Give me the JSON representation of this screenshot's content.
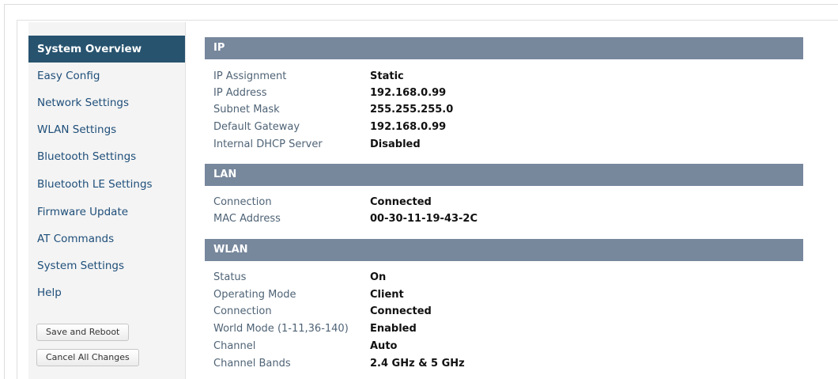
{
  "sidebar": {
    "items": [
      {
        "label": "System Overview"
      },
      {
        "label": "Easy Config"
      },
      {
        "label": "Network Settings"
      },
      {
        "label": "WLAN Settings"
      },
      {
        "label": "Bluetooth Settings"
      },
      {
        "label": "Bluetooth LE Settings"
      },
      {
        "label": "Firmware Update"
      },
      {
        "label": "AT Commands"
      },
      {
        "label": "System Settings"
      },
      {
        "label": "Help"
      }
    ],
    "save_button": "Save and Reboot",
    "cancel_button": "Cancel All Changes"
  },
  "sections": {
    "ip": {
      "title": "IP",
      "rows": [
        {
          "label": "IP Assignment",
          "value": "Static"
        },
        {
          "label": "IP Address",
          "value": "192.168.0.99"
        },
        {
          "label": "Subnet Mask",
          "value": "255.255.255.0"
        },
        {
          "label": "Default Gateway",
          "value": "192.168.0.99"
        },
        {
          "label": "Internal DHCP Server",
          "value": "Disabled"
        }
      ]
    },
    "lan": {
      "title": "LAN",
      "rows": [
        {
          "label": "Connection",
          "value": "Connected"
        },
        {
          "label": "MAC Address",
          "value": "00-30-11-19-43-2C"
        }
      ]
    },
    "wlan": {
      "title": "WLAN",
      "rows": [
        {
          "label": "Status",
          "value": "On"
        },
        {
          "label": "Operating Mode",
          "value": "Client"
        },
        {
          "label": "Connection",
          "value": "Connected"
        },
        {
          "label": "World Mode (1-11,36-140)",
          "value": "Enabled"
        },
        {
          "label": "Channel",
          "value": "Auto"
        },
        {
          "label": "Channel Bands",
          "value": "2.4 GHz & 5 GHz"
        }
      ]
    }
  }
}
